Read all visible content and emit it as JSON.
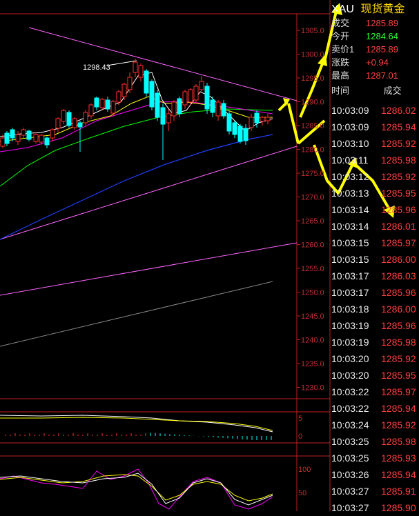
{
  "chart": {
    "annotation_high": "1298.43",
    "price_axis": [
      "1305.0",
      "1300.0",
      "1295.0",
      "1290.0",
      "1285.0",
      "1280.0",
      "1275.0",
      "1270.0",
      "1265.0",
      "1260.0",
      "1255.0",
      "1250.0",
      "1245.0",
      "1240.0",
      "1235.0",
      "1230.0"
    ],
    "macd_axis": [
      "5",
      "0"
    ],
    "kdj_axis": [
      "100",
      "50"
    ],
    "colors": {
      "up": "#ff3030",
      "down": "#00ffff",
      "ma_white": "#ffffff",
      "ma_yellow": "#ffff00",
      "ma_magenta": "#ff00ff",
      "ma_green": "#00ff00",
      "ma_blue": "#2040ff",
      "trend": "#ff66ff",
      "arrow": "#ffff00"
    }
  },
  "quote": {
    "symbol": "XAU",
    "name": "现货黄金",
    "fields": [
      {
        "label": "成交",
        "value": "1285.89",
        "color": "#ff4040"
      },
      {
        "label": "今开",
        "value": "1284.64",
        "color": "#30ff30"
      },
      {
        "label": "卖价1",
        "value": "1285.89",
        "color": "#ff4040"
      },
      {
        "label": "涨跌",
        "value": "+0.94",
        "color": "#ff4040"
      },
      {
        "label": "最高",
        "value": "1287.01",
        "color": "#ff4040"
      }
    ],
    "trades_header": {
      "time": "时间",
      "price": "成交"
    },
    "trades": [
      {
        "time": "10:03:09",
        "price": "1286.02",
        "color": "#ff4040"
      },
      {
        "time": "10:03:09",
        "price": "1285.94",
        "color": "#ff4040"
      },
      {
        "time": "10:03:10",
        "price": "1285.92",
        "color": "#ff4040"
      },
      {
        "time": "10:03:11",
        "price": "1285.98",
        "color": "#ff4040"
      },
      {
        "time": "10:03:12",
        "price": "1285.92",
        "color": "#ff4040"
      },
      {
        "time": "10:03:13",
        "price": "1285.95",
        "color": "#ff4040"
      },
      {
        "time": "10:03:14",
        "price": "1285.96",
        "color": "#ff4040"
      },
      {
        "time": "10:03:14",
        "price": "1286.01",
        "color": "#ff4040"
      },
      {
        "time": "10:03:15",
        "price": "1285.97",
        "color": "#ff4040"
      },
      {
        "time": "10:03:15",
        "price": "1286.00",
        "color": "#ff4040"
      },
      {
        "time": "10:03:17",
        "price": "1286.03",
        "color": "#ff4040"
      },
      {
        "time": "10:03:17",
        "price": "1285.96",
        "color": "#ff4040"
      },
      {
        "time": "10:03:18",
        "price": "1286.00",
        "color": "#ff4040"
      },
      {
        "time": "10:03:19",
        "price": "1285.96",
        "color": "#ff4040"
      },
      {
        "time": "10:03:19",
        "price": "1285.98",
        "color": "#ff4040"
      },
      {
        "time": "10:03:20",
        "price": "1285.92",
        "color": "#ff4040"
      },
      {
        "time": "10:03:20",
        "price": "1285.95",
        "color": "#ff4040"
      },
      {
        "time": "10:03:22",
        "price": "1285.97",
        "color": "#ff4040"
      },
      {
        "time": "10:03:22",
        "price": "1285.94",
        "color": "#ff4040"
      },
      {
        "time": "10:03:24",
        "price": "1285.92",
        "color": "#ff4040"
      },
      {
        "time": "10:03:25",
        "price": "1285.98",
        "color": "#ff4040"
      },
      {
        "time": "10:03:25",
        "price": "1285.93",
        "color": "#ff4040"
      },
      {
        "time": "10:03:26",
        "price": "1285.94",
        "color": "#ff4040"
      },
      {
        "time": "10:03:27",
        "price": "1285.91",
        "color": "#ff4040"
      },
      {
        "time": "10:03:27",
        "price": "1285.90",
        "color": "#ff4040"
      }
    ]
  }
}
